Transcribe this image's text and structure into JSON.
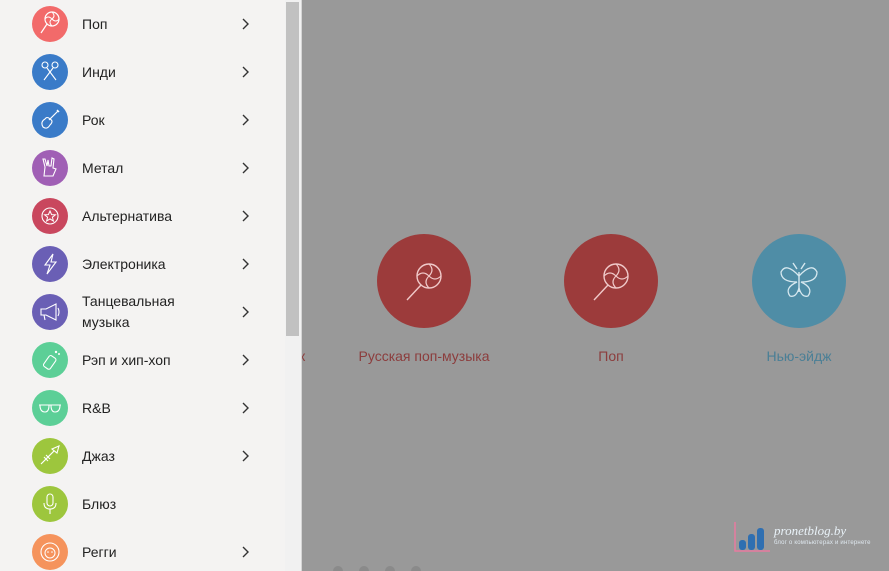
{
  "drawer": {
    "items": [
      {
        "label": "Поп",
        "icon": "lollipop-icon",
        "color": "#f26a6a",
        "has_submenu": true
      },
      {
        "label": "Инди",
        "icon": "microphones-icon",
        "color": "#3a7bc8",
        "has_submenu": true
      },
      {
        "label": "Рок",
        "icon": "guitar-icon",
        "color": "#3a7bc8",
        "has_submenu": true
      },
      {
        "label": "Метал",
        "icon": "rock-hand-icon",
        "color": "#a05fb5",
        "has_submenu": true
      },
      {
        "label": "Альтернатива",
        "icon": "star-badge-icon",
        "color": "#c9475e",
        "has_submenu": true
      },
      {
        "label": "Электроника",
        "icon": "lightning-icon",
        "color": "#6a5fb5",
        "has_submenu": true
      },
      {
        "label": "Танцевальная музыка",
        "icon": "megaphone-icon",
        "color": "#6a5fb5",
        "has_submenu": true
      },
      {
        "label": "Рэп и хип-хоп",
        "icon": "spray-can-icon",
        "color": "#5ccf97",
        "has_submenu": true
      },
      {
        "label": "R&B",
        "icon": "sunglasses-icon",
        "color": "#5ccf97",
        "has_submenu": true
      },
      {
        "label": "Джаз",
        "icon": "trumpet-icon",
        "color": "#9dc63d",
        "has_submenu": true
      },
      {
        "label": "Блюз",
        "icon": "microphone-icon",
        "color": "#9dc63d",
        "has_submenu": false
      },
      {
        "label": "Регги",
        "icon": "lion-icon",
        "color": "#f5935c",
        "has_submenu": true
      }
    ]
  },
  "background": {
    "partial_label": "к",
    "tiles": [
      {
        "label": "Русская поп-музыка",
        "icon": "lollipop-icon",
        "circle_color": "#9c3b3b",
        "label_color": "#8c3d3d"
      },
      {
        "label": "Поп",
        "icon": "lollipop-icon",
        "circle_color": "#9c3b3b",
        "label_color": "#8c3d3d"
      },
      {
        "label": "Нью-эйдж",
        "icon": "butterfly-icon",
        "circle_color": "#4f8da6",
        "label_color": "#4a7f96"
      }
    ]
  },
  "watermark": {
    "title": "pronetblog.by",
    "subtitle": "блог о компьютерах и интернете"
  }
}
